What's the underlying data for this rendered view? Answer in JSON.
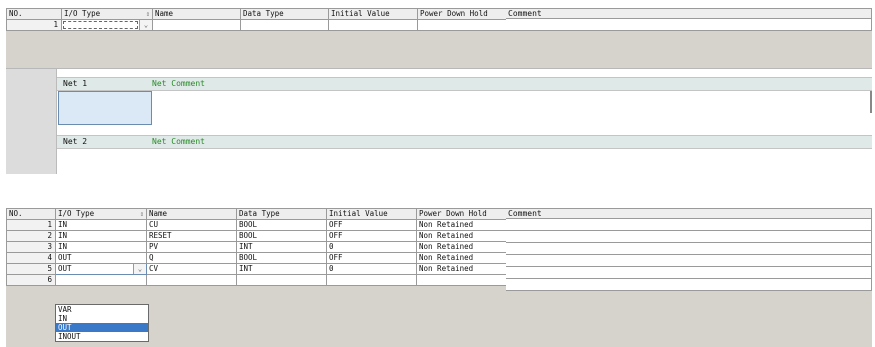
{
  "columns": {
    "no": "NO.",
    "io_type": "I/O Type",
    "name": "Name",
    "data_type": "Data Type",
    "initial_value": "Initial Value",
    "power_down_hold": "Power Down Hold",
    "comment": "Comment"
  },
  "panel1": {
    "rows": [
      {
        "no": "1",
        "io_type": "",
        "name": "",
        "data_type": "",
        "initial_value": "",
        "power_down_hold": "",
        "comment": ""
      }
    ],
    "networks": [
      {
        "label": "Net 1",
        "comment": "Net Comment"
      },
      {
        "label": "Net 2",
        "comment": "Net Comment"
      }
    ]
  },
  "panel2": {
    "rows": [
      {
        "no": "1",
        "io_type": "IN",
        "name": "CU",
        "data_type": "BOOL",
        "initial_value": "OFF",
        "power_down_hold": "Non Retained",
        "comment": ""
      },
      {
        "no": "2",
        "io_type": "IN",
        "name": "RESET",
        "data_type": "BOOL",
        "initial_value": "OFF",
        "power_down_hold": "Non Retained",
        "comment": ""
      },
      {
        "no": "3",
        "io_type": "IN",
        "name": "PV",
        "data_type": "INT",
        "initial_value": "0",
        "power_down_hold": "Non Retained",
        "comment": ""
      },
      {
        "no": "4",
        "io_type": "OUT",
        "name": "Q",
        "data_type": "BOOL",
        "initial_value": "OFF",
        "power_down_hold": "Non Retained",
        "comment": ""
      },
      {
        "no": "5",
        "io_type": "OUT",
        "name": "CV",
        "data_type": "INT",
        "initial_value": "0",
        "power_down_hold": "Non Retained",
        "comment": ""
      },
      {
        "no": "6",
        "io_type": "",
        "name": "",
        "data_type": "",
        "initial_value": "",
        "power_down_hold": "",
        "comment": ""
      }
    ],
    "dropdown_options": [
      "VAR",
      "IN",
      "OUT",
      "INOUT"
    ],
    "dropdown_selected": "OUT"
  },
  "icons": {
    "sort": "sort-arrows-icon",
    "dropdown": "chevron-down-icon"
  }
}
